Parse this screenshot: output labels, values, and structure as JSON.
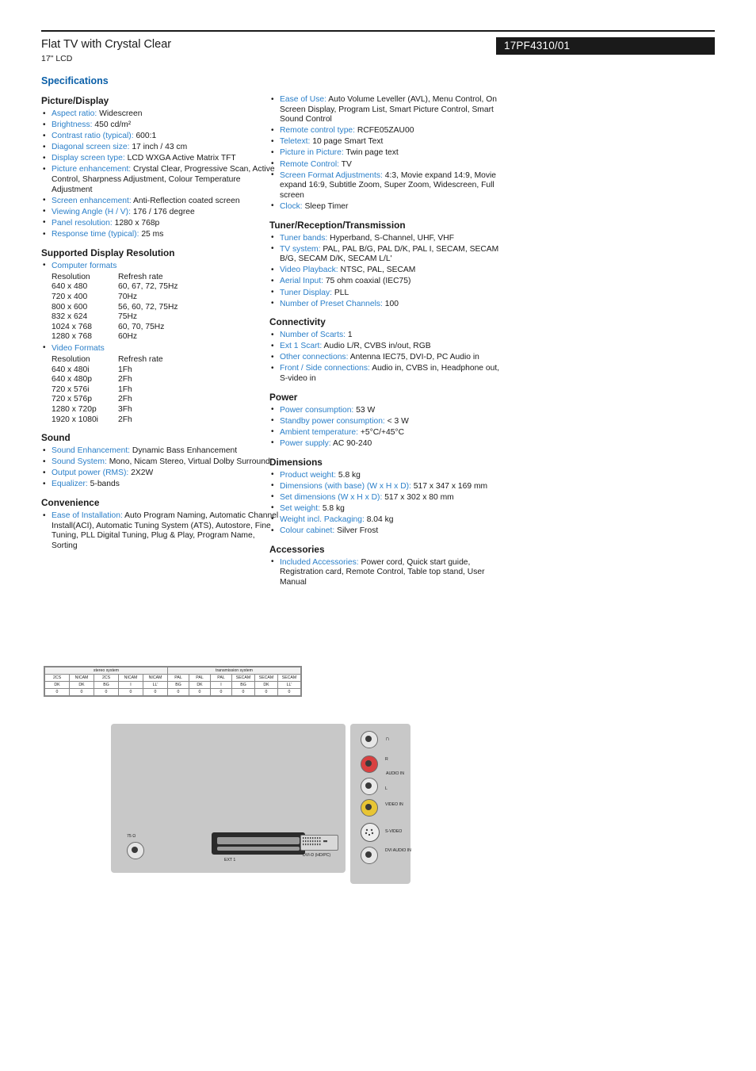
{
  "header": {
    "title": "Flat TV with Crystal Clear",
    "subtitle": "17\" LCD",
    "model": "17PF4310/01",
    "specs_heading": "Specifications"
  },
  "left": {
    "picture_display": {
      "heading": "Picture/Display",
      "items": [
        {
          "k": "Aspect ratio:",
          "v": "Widescreen"
        },
        {
          "k": "Brightness:",
          "v": "450 cd/m²"
        },
        {
          "k": "Contrast ratio (typical):",
          "v": "600:1"
        },
        {
          "k": "Diagonal screen size:",
          "v": "17 inch / 43 cm"
        },
        {
          "k": "Display screen type:",
          "v": "LCD WXGA Active Matrix TFT"
        },
        {
          "k": "Picture enhancement:",
          "v": "Crystal Clear, Progressive Scan, Active Control, Sharpness Adjustment, Colour Temperature Adjustment"
        },
        {
          "k": "Screen enhancement:",
          "v": "Anti-Reflection coated screen"
        },
        {
          "k": "Viewing Angle (H / V):",
          "v": "176 / 176 degree"
        },
        {
          "k": "Panel resolution:",
          "v": "1280 x 768p"
        },
        {
          "k": "Response time (typical):",
          "v": "25 ms"
        }
      ]
    },
    "supported_resolution": {
      "heading": "Supported Display Resolution",
      "computer_label": "Computer formats",
      "computer_header": {
        "res": "Resolution",
        "rate": "Refresh rate"
      },
      "computer_rows": [
        {
          "res": "640 x 480",
          "rate": "60, 67, 72, 75Hz"
        },
        {
          "res": "720 x 400",
          "rate": "70Hz"
        },
        {
          "res": "800 x 600",
          "rate": "56, 60, 72, 75Hz"
        },
        {
          "res": "832 x 624",
          "rate": "75Hz"
        },
        {
          "res": "1024 x 768",
          "rate": "60, 70, 75Hz"
        },
        {
          "res": "1280 x 768",
          "rate": "60Hz"
        }
      ],
      "video_label": "Video Formats",
      "video_header": {
        "res": "Resolution",
        "rate": "Refresh rate"
      },
      "video_rows": [
        {
          "res": "640 x 480i",
          "rate": "1Fh"
        },
        {
          "res": "640 x 480p",
          "rate": "2Fh"
        },
        {
          "res": "720 x 576i",
          "rate": "1Fh"
        },
        {
          "res": "720 x 576p",
          "rate": "2Fh"
        },
        {
          "res": "1280 x 720p",
          "rate": "3Fh"
        },
        {
          "res": "1920 x 1080i",
          "rate": "2Fh"
        }
      ]
    },
    "sound": {
      "heading": "Sound",
      "items": [
        {
          "k": "Sound Enhancement:",
          "v": "Dynamic Bass Enhancement"
        },
        {
          "k": "Sound System:",
          "v": "Mono, Nicam Stereo, Virtual Dolby Surround"
        },
        {
          "k": "Output power (RMS):",
          "v": "2X2W"
        },
        {
          "k": "Equalizer:",
          "v": "5-bands"
        }
      ]
    },
    "convenience": {
      "heading": "Convenience",
      "items": [
        {
          "k": "Ease of Installation:",
          "v": "Auto Program Naming, Automatic Channel Install(ACI), Automatic Tuning System (ATS), Autostore, Fine Tuning, PLL Digital Tuning, Plug & Play, Program Name, Sorting"
        }
      ]
    }
  },
  "right": {
    "convenience_cont": {
      "items": [
        {
          "k": "Ease of Use:",
          "v": "Auto Volume Leveller (AVL), Menu Control, On Screen Display, Program List, Smart Picture Control, Smart Sound Control"
        },
        {
          "k": "Remote control type:",
          "v": "RCFE05ZAU00"
        },
        {
          "k": "Teletext:",
          "v": "10 page Smart Text"
        },
        {
          "k": "Picture in Picture:",
          "v": "Twin page text"
        },
        {
          "k": "Remote Control:",
          "v": "TV"
        },
        {
          "k": "Screen Format Adjustments:",
          "v": "4:3, Movie expand 14:9, Movie expand 16:9, Subtitle Zoom, Super Zoom, Widescreen, Full screen"
        },
        {
          "k": "Clock:",
          "v": "Sleep Timer"
        }
      ]
    },
    "tuner": {
      "heading": "Tuner/Reception/Transmission",
      "items": [
        {
          "k": "Tuner bands:",
          "v": "Hyperband, S-Channel, UHF, VHF"
        },
        {
          "k": "TV system:",
          "v": "PAL, PAL B/G, PAL D/K, PAL I, SECAM, SECAM B/G, SECAM D/K, SECAM L/L'"
        },
        {
          "k": "Video Playback:",
          "v": "NTSC, PAL, SECAM"
        },
        {
          "k": "Aerial Input:",
          "v": "75 ohm coaxial (IEC75)"
        },
        {
          "k": "Tuner Display:",
          "v": "PLL"
        },
        {
          "k": "Number of Preset Channels:",
          "v": "100"
        }
      ]
    },
    "connectivity": {
      "heading": "Connectivity",
      "items": [
        {
          "k": "Number of Scarts:",
          "v": "1"
        },
        {
          "k": "Ext 1 Scart:",
          "v": "Audio L/R, CVBS in/out, RGB"
        },
        {
          "k": "Other connections:",
          "v": "Antenna IEC75, DVI-D, PC Audio in"
        },
        {
          "k": "Front / Side connections:",
          "v": "Audio in, CVBS in, Headphone out, S-video in"
        }
      ]
    },
    "power": {
      "heading": "Power",
      "items": [
        {
          "k": "Power consumption:",
          "v": "53 W"
        },
        {
          "k": "Standby power consumption:",
          "v": "< 3 W"
        },
        {
          "k": "Ambient temperature:",
          "v": "+5°C/+45°C"
        },
        {
          "k": "Power supply:",
          "v": "AC 90-240"
        }
      ]
    },
    "dimensions": {
      "heading": "Dimensions",
      "items": [
        {
          "k": "Product weight:",
          "v": "5.8 kg"
        },
        {
          "k": "Dimensions (with base) (W x H x D):",
          "v": "517 x 347 x 169 mm"
        },
        {
          "k": "Set dimensions (W x H x D):",
          "v": "517 x 302 x 80 mm"
        },
        {
          "k": "Set weight:",
          "v": "5.8 kg"
        },
        {
          "k": "Weight incl. Packaging:",
          "v": "8.04 kg"
        },
        {
          "k": "Colour cabinet:",
          "v": "Silver Frost"
        }
      ]
    },
    "accessories": {
      "heading": "Accessories",
      "items": [
        {
          "k": "Included Accessories:",
          "v": "Power cord, Quick start guide, Registration card, Remote Control, Table top stand, User Manual"
        }
      ]
    }
  },
  "system_table": {
    "group_headers": [
      "stereo system",
      "transmission system"
    ],
    "row1": [
      "2CS",
      "NICAM",
      "2CS",
      "NICAM",
      "NICAM",
      "PAL",
      "PAL",
      "PAL",
      "SECAM",
      "SECAM",
      "SECAM"
    ],
    "row2": [
      "DK",
      "DK",
      "BG",
      "I",
      "LL'",
      "BG",
      "DK",
      "I",
      "BG",
      "DK",
      "LL'"
    ],
    "row3": [
      "0",
      "0",
      "0",
      "0",
      "0",
      "0",
      "0",
      "0",
      "0",
      "0",
      "0"
    ]
  },
  "connectors": {
    "scart_label": "EXT 1",
    "dvi_label": "DVI-D (HD/PC)",
    "antenna_label_top": "75 Ω",
    "antenna_label_bottom": "→",
    "side": {
      "headphone": "∩",
      "audio_in": "AUDIO IN",
      "audio_in_r": "R",
      "audio_in_l": "L",
      "video_in": "VIDEO IN",
      "svideo": "S-VIDEO",
      "dvi_audio_in": "DVI AUDIO IN"
    }
  }
}
